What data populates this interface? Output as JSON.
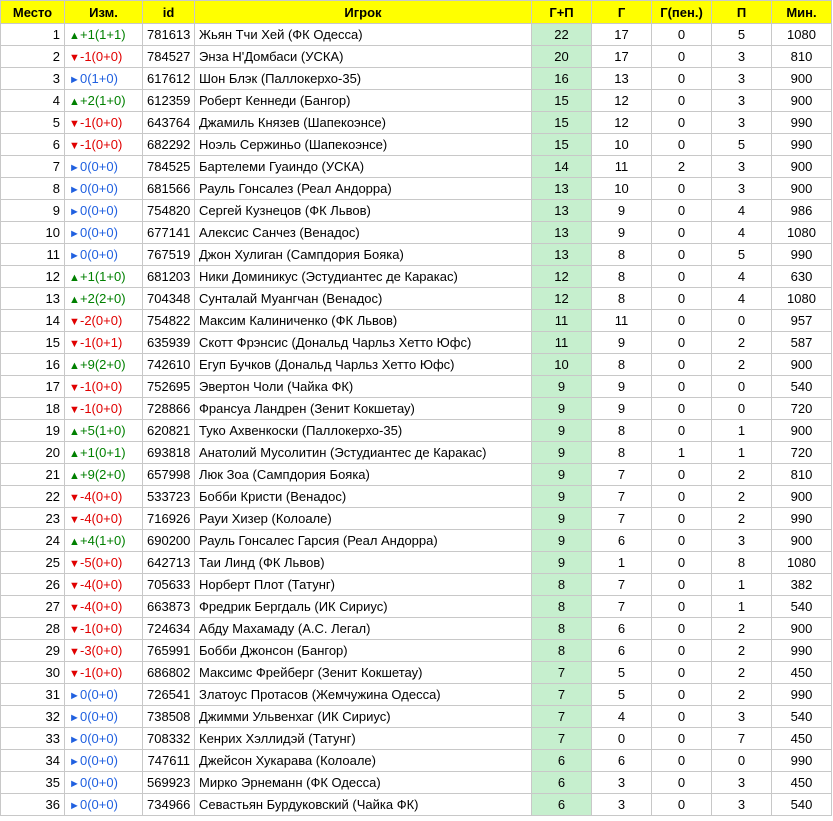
{
  "colors": {
    "header_bg": "#ffff00",
    "gp_bg": "#c6efce",
    "up": "#008000",
    "down": "#e00000",
    "same": "#2060e0"
  },
  "headers": [
    "Место",
    "Изм.",
    "id",
    "Игрок",
    "Г+П",
    "Г",
    "Г(пен.)",
    "П",
    "Мин."
  ],
  "rows": [
    {
      "place": "1",
      "dir": "up",
      "chg": "+1(1+1)",
      "id": "781613",
      "player": "Жьян Тчи Хей (ФК Одесса)",
      "gp": "22",
      "g": "17",
      "pen": "0",
      "a": "5",
      "min": "1080"
    },
    {
      "place": "2",
      "dir": "down",
      "chg": "-1(0+0)",
      "id": "784527",
      "player": "Энза Н'Домбаси (УСКА)",
      "gp": "20",
      "g": "17",
      "pen": "0",
      "a": "3",
      "min": "810"
    },
    {
      "place": "3",
      "dir": "same",
      "chg": "0(1+0)",
      "id": "617612",
      "player": "Шон Блэк (Паллокерхо-35)",
      "gp": "16",
      "g": "13",
      "pen": "0",
      "a": "3",
      "min": "900"
    },
    {
      "place": "4",
      "dir": "up",
      "chg": "+2(1+0)",
      "id": "612359",
      "player": "Роберт Кеннеди (Бангор)",
      "gp": "15",
      "g": "12",
      "pen": "0",
      "a": "3",
      "min": "900"
    },
    {
      "place": "5",
      "dir": "down",
      "chg": "-1(0+0)",
      "id": "643764",
      "player": "Джамиль Князев (Шапекоэнсе)",
      "gp": "15",
      "g": "12",
      "pen": "0",
      "a": "3",
      "min": "990"
    },
    {
      "place": "6",
      "dir": "down",
      "chg": "-1(0+0)",
      "id": "682292",
      "player": "Ноэль Сержиньо (Шапекоэнсе)",
      "gp": "15",
      "g": "10",
      "pen": "0",
      "a": "5",
      "min": "990"
    },
    {
      "place": "7",
      "dir": "same",
      "chg": "0(0+0)",
      "id": "784525",
      "player": "Бартелеми Гуаиндо (УСКА)",
      "gp": "14",
      "g": "11",
      "pen": "2",
      "a": "3",
      "min": "900"
    },
    {
      "place": "8",
      "dir": "same",
      "chg": "0(0+0)",
      "id": "681566",
      "player": "Рауль Гонсалез (Реал Андорра)",
      "gp": "13",
      "g": "10",
      "pen": "0",
      "a": "3",
      "min": "900"
    },
    {
      "place": "9",
      "dir": "same",
      "chg": "0(0+0)",
      "id": "754820",
      "player": "Сергей Кузнецов (ФК Львов)",
      "gp": "13",
      "g": "9",
      "pen": "0",
      "a": "4",
      "min": "986"
    },
    {
      "place": "10",
      "dir": "same",
      "chg": "0(0+0)",
      "id": "677141",
      "player": "Алексис Санчез (Венадос)",
      "gp": "13",
      "g": "9",
      "pen": "0",
      "a": "4",
      "min": "1080"
    },
    {
      "place": "11",
      "dir": "same",
      "chg": "0(0+0)",
      "id": "767519",
      "player": "Джон Хулиган (Сампдория Бояка)",
      "gp": "13",
      "g": "8",
      "pen": "0",
      "a": "5",
      "min": "990"
    },
    {
      "place": "12",
      "dir": "up",
      "chg": "+1(1+0)",
      "id": "681203",
      "player": "Ники Доминикус (Эстудиантес де Каракас)",
      "gp": "12",
      "g": "8",
      "pen": "0",
      "a": "4",
      "min": "630"
    },
    {
      "place": "13",
      "dir": "up",
      "chg": "+2(2+0)",
      "id": "704348",
      "player": "Сунталай Муангчан (Венадос)",
      "gp": "12",
      "g": "8",
      "pen": "0",
      "a": "4",
      "min": "1080"
    },
    {
      "place": "14",
      "dir": "down",
      "chg": "-2(0+0)",
      "id": "754822",
      "player": "Максим Калиниченко (ФК Львов)",
      "gp": "11",
      "g": "11",
      "pen": "0",
      "a": "0",
      "min": "957"
    },
    {
      "place": "15",
      "dir": "down",
      "chg": "-1(0+1)",
      "id": "635939",
      "player": "Скотт Фрэнсис (Дональд Чарльз Хетто Юфс)",
      "gp": "11",
      "g": "9",
      "pen": "0",
      "a": "2",
      "min": "587"
    },
    {
      "place": "16",
      "dir": "up",
      "chg": "+9(2+0)",
      "id": "742610",
      "player": "Егуп Бучков (Дональд Чарльз Хетто Юфс)",
      "gp": "10",
      "g": "8",
      "pen": "0",
      "a": "2",
      "min": "900"
    },
    {
      "place": "17",
      "dir": "down",
      "chg": "-1(0+0)",
      "id": "752695",
      "player": "Эвертон Чоли (Чайка ФК)",
      "gp": "9",
      "g": "9",
      "pen": "0",
      "a": "0",
      "min": "540"
    },
    {
      "place": "18",
      "dir": "down",
      "chg": "-1(0+0)",
      "id": "728866",
      "player": "Франсуа Ландрен (Зенит Кокшетау)",
      "gp": "9",
      "g": "9",
      "pen": "0",
      "a": "0",
      "min": "720"
    },
    {
      "place": "19",
      "dir": "up",
      "chg": "+5(1+0)",
      "id": "620821",
      "player": "Туко Ахвенкоски (Паллокерхо-35)",
      "gp": "9",
      "g": "8",
      "pen": "0",
      "a": "1",
      "min": "900"
    },
    {
      "place": "20",
      "dir": "up",
      "chg": "+1(0+1)",
      "id": "693818",
      "player": "Анатолий Мусолитин (Эстудиантес де Каракас)",
      "gp": "9",
      "g": "8",
      "pen": "1",
      "a": "1",
      "min": "720"
    },
    {
      "place": "21",
      "dir": "up",
      "chg": "+9(2+0)",
      "id": "657998",
      "player": "Люк Зоа (Сампдория Бояка)",
      "gp": "9",
      "g": "7",
      "pen": "0",
      "a": "2",
      "min": "810"
    },
    {
      "place": "22",
      "dir": "down",
      "chg": "-4(0+0)",
      "id": "533723",
      "player": "Бобби Кристи (Венадос)",
      "gp": "9",
      "g": "7",
      "pen": "0",
      "a": "2",
      "min": "900"
    },
    {
      "place": "23",
      "dir": "down",
      "chg": "-4(0+0)",
      "id": "716926",
      "player": "Рауи Хизер (Колоале)",
      "gp": "9",
      "g": "7",
      "pen": "0",
      "a": "2",
      "min": "990"
    },
    {
      "place": "24",
      "dir": "up",
      "chg": "+4(1+0)",
      "id": "690200",
      "player": "Рауль Гонсалес Гарсия (Реал Андорра)",
      "gp": "9",
      "g": "6",
      "pen": "0",
      "a": "3",
      "min": "900"
    },
    {
      "place": "25",
      "dir": "down",
      "chg": "-5(0+0)",
      "id": "642713",
      "player": "Таи Линд (ФК Львов)",
      "gp": "9",
      "g": "1",
      "pen": "0",
      "a": "8",
      "min": "1080"
    },
    {
      "place": "26",
      "dir": "down",
      "chg": "-4(0+0)",
      "id": "705633",
      "player": "Норберт Плот (Татунг)",
      "gp": "8",
      "g": "7",
      "pen": "0",
      "a": "1",
      "min": "382"
    },
    {
      "place": "27",
      "dir": "down",
      "chg": "-4(0+0)",
      "id": "663873",
      "player": "Фредрик Бергдаль (ИК Сириус)",
      "gp": "8",
      "g": "7",
      "pen": "0",
      "a": "1",
      "min": "540"
    },
    {
      "place": "28",
      "dir": "down",
      "chg": "-1(0+0)",
      "id": "724634",
      "player": "Абду Махамаду (А.С. Легал)",
      "gp": "8",
      "g": "6",
      "pen": "0",
      "a": "2",
      "min": "900"
    },
    {
      "place": "29",
      "dir": "down",
      "chg": "-3(0+0)",
      "id": "765991",
      "player": "Бобби Джонсон (Бангор)",
      "gp": "8",
      "g": "6",
      "pen": "0",
      "a": "2",
      "min": "990"
    },
    {
      "place": "30",
      "dir": "down",
      "chg": "-1(0+0)",
      "id": "686802",
      "player": "Максимс Фрейберг (Зенит Кокшетау)",
      "gp": "7",
      "g": "5",
      "pen": "0",
      "a": "2",
      "min": "450"
    },
    {
      "place": "31",
      "dir": "same",
      "chg": "0(0+0)",
      "id": "726541",
      "player": "Златоус Протасов (Жемчужина Одесса)",
      "gp": "7",
      "g": "5",
      "pen": "0",
      "a": "2",
      "min": "990"
    },
    {
      "place": "32",
      "dir": "same",
      "chg": "0(0+0)",
      "id": "738508",
      "player": "Джимми Ульвенхаг (ИК Сириус)",
      "gp": "7",
      "g": "4",
      "pen": "0",
      "a": "3",
      "min": "540"
    },
    {
      "place": "33",
      "dir": "same",
      "chg": "0(0+0)",
      "id": "708332",
      "player": "Кенрих Хэллидэй (Татунг)",
      "gp": "7",
      "g": "0",
      "pen": "0",
      "a": "7",
      "min": "450"
    },
    {
      "place": "34",
      "dir": "same",
      "chg": "0(0+0)",
      "id": "747611",
      "player": "Джейсон Хукарава (Колоале)",
      "gp": "6",
      "g": "6",
      "pen": "0",
      "a": "0",
      "min": "990"
    },
    {
      "place": "35",
      "dir": "same",
      "chg": "0(0+0)",
      "id": "569923",
      "player": "Мирко Эрнеманн (ФК Одесса)",
      "gp": "6",
      "g": "3",
      "pen": "0",
      "a": "3",
      "min": "450"
    },
    {
      "place": "36",
      "dir": "same",
      "chg": "0(0+0)",
      "id": "734966",
      "player": "Севастьян Бурдуковский (Чайка ФК)",
      "gp": "6",
      "g": "3",
      "pen": "0",
      "a": "3",
      "min": "540"
    }
  ]
}
